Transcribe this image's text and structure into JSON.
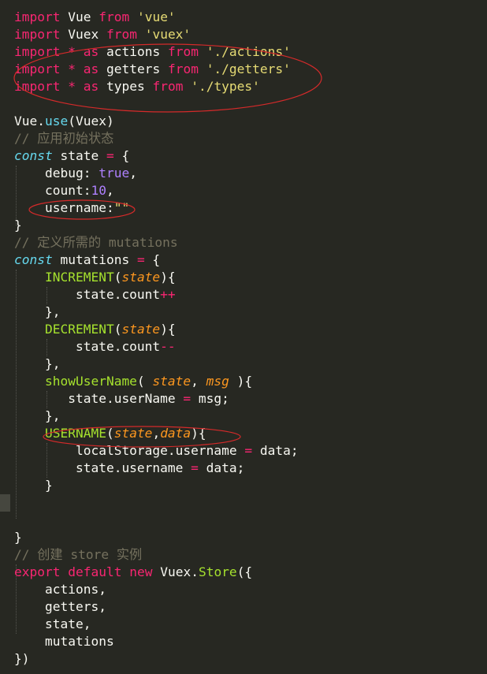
{
  "editor": {
    "annotation_color": "#D42A2A",
    "lines": [
      {
        "segments": [
          {
            "t": "import",
            "c": "kw"
          },
          {
            "t": " Vue "
          },
          {
            "t": "from",
            "c": "kw"
          },
          {
            "t": " "
          },
          {
            "t": "'vue'",
            "c": "str"
          }
        ]
      },
      {
        "segments": [
          {
            "t": "import",
            "c": "kw"
          },
          {
            "t": " Vuex "
          },
          {
            "t": "from",
            "c": "kw"
          },
          {
            "t": " "
          },
          {
            "t": "'vuex'",
            "c": "str"
          }
        ]
      },
      {
        "segments": [
          {
            "t": "import",
            "c": "kw"
          },
          {
            "t": " "
          },
          {
            "t": "*",
            "c": "kw"
          },
          {
            "t": " "
          },
          {
            "t": "as",
            "c": "kw"
          },
          {
            "t": " actions "
          },
          {
            "t": "from",
            "c": "kw"
          },
          {
            "t": " "
          },
          {
            "t": "'./actions'",
            "c": "str"
          }
        ]
      },
      {
        "segments": [
          {
            "t": "import",
            "c": "kw"
          },
          {
            "t": " "
          },
          {
            "t": "*",
            "c": "kw"
          },
          {
            "t": " "
          },
          {
            "t": "as",
            "c": "kw"
          },
          {
            "t": " getters "
          },
          {
            "t": "from",
            "c": "kw"
          },
          {
            "t": " "
          },
          {
            "t": "'./getters'",
            "c": "str"
          }
        ]
      },
      {
        "segments": [
          {
            "t": "import",
            "c": "kw"
          },
          {
            "t": " "
          },
          {
            "t": "*",
            "c": "kw"
          },
          {
            "t": " "
          },
          {
            "t": "as",
            "c": "kw"
          },
          {
            "t": " types "
          },
          {
            "t": "from",
            "c": "kw"
          },
          {
            "t": " "
          },
          {
            "t": "'./types'",
            "c": "str"
          }
        ]
      },
      {
        "segments": []
      },
      {
        "segments": [
          {
            "t": "Vue."
          },
          {
            "t": "use",
            "c": "bi"
          },
          {
            "t": "(Vuex)"
          }
        ]
      },
      {
        "segments": [
          {
            "t": "// 应用初始状态",
            "c": "cmt"
          }
        ]
      },
      {
        "segments": [
          {
            "t": "const",
            "c": "fn"
          },
          {
            "t": " state "
          },
          {
            "t": "=",
            "c": "kw"
          },
          {
            "t": " {"
          }
        ]
      },
      {
        "segments": [
          {
            "t": "    debug: "
          },
          {
            "t": "true",
            "c": "num"
          },
          {
            "t": ","
          }
        ]
      },
      {
        "segments": [
          {
            "t": "    count:"
          },
          {
            "t": "10",
            "c": "num"
          },
          {
            "t": ","
          }
        ]
      },
      {
        "segments": [
          {
            "t": "    username:"
          },
          {
            "t": "\"\"",
            "c": "str"
          }
        ]
      },
      {
        "segments": [
          {
            "t": "}"
          }
        ]
      },
      {
        "segments": [
          {
            "t": "// 定义所需的 mutations",
            "c": "cmt"
          }
        ]
      },
      {
        "segments": [
          {
            "t": "const",
            "c": "fn"
          },
          {
            "t": " mutations "
          },
          {
            "t": "=",
            "c": "kw"
          },
          {
            "t": " {"
          }
        ]
      },
      {
        "segments": [
          {
            "t": "    "
          },
          {
            "t": "INCREMENT",
            "c": "prop"
          },
          {
            "t": "("
          },
          {
            "t": "state",
            "c": "par"
          },
          {
            "t": "){"
          }
        ]
      },
      {
        "segments": [
          {
            "t": "        state.count"
          },
          {
            "t": "++",
            "c": "kw"
          }
        ]
      },
      {
        "segments": [
          {
            "t": "    },"
          }
        ]
      },
      {
        "segments": [
          {
            "t": "    "
          },
          {
            "t": "DECREMENT",
            "c": "prop"
          },
          {
            "t": "("
          },
          {
            "t": "state",
            "c": "par"
          },
          {
            "t": "){"
          }
        ]
      },
      {
        "segments": [
          {
            "t": "        state.count"
          },
          {
            "t": "--",
            "c": "kw"
          }
        ]
      },
      {
        "segments": [
          {
            "t": "    },"
          }
        ]
      },
      {
        "segments": [
          {
            "t": "    "
          },
          {
            "t": "showUserName",
            "c": "prop"
          },
          {
            "t": "( "
          },
          {
            "t": "state",
            "c": "par"
          },
          {
            "t": ", "
          },
          {
            "t": "msg",
            "c": "par"
          },
          {
            "t": " ){"
          }
        ]
      },
      {
        "segments": [
          {
            "t": "       state.userName "
          },
          {
            "t": "=",
            "c": "kw"
          },
          {
            "t": " msg;"
          }
        ]
      },
      {
        "segments": [
          {
            "t": "    },"
          }
        ]
      },
      {
        "segments": [
          {
            "t": "    "
          },
          {
            "t": "USERNAME",
            "c": "prop"
          },
          {
            "t": "("
          },
          {
            "t": "state",
            "c": "par"
          },
          {
            "t": ","
          },
          {
            "t": "data",
            "c": "par"
          },
          {
            "t": "){"
          }
        ]
      },
      {
        "segments": [
          {
            "t": "        localStorage.username "
          },
          {
            "t": "=",
            "c": "kw"
          },
          {
            "t": " data;"
          }
        ]
      },
      {
        "segments": [
          {
            "t": "        state.username "
          },
          {
            "t": "=",
            "c": "kw"
          },
          {
            "t": " data;"
          }
        ]
      },
      {
        "segments": [
          {
            "t": "    }"
          }
        ]
      },
      {
        "segments": []
      },
      {
        "segments": []
      },
      {
        "segments": [
          {
            "t": "}"
          }
        ]
      },
      {
        "segments": [
          {
            "t": "// 创建 store 实例",
            "c": "cmt"
          }
        ]
      },
      {
        "segments": [
          {
            "t": "export",
            "c": "kw"
          },
          {
            "t": " "
          },
          {
            "t": "default",
            "c": "kw"
          },
          {
            "t": " "
          },
          {
            "t": "new",
            "c": "kw"
          },
          {
            "t": " Vuex."
          },
          {
            "t": "Store",
            "c": "prop"
          },
          {
            "t": "({"
          }
        ]
      },
      {
        "segments": [
          {
            "t": "    actions,"
          }
        ]
      },
      {
        "segments": [
          {
            "t": "    getters,"
          }
        ]
      },
      {
        "segments": [
          {
            "t": "    state,"
          }
        ]
      },
      {
        "segments": [
          {
            "t": "    mutations"
          }
        ]
      },
      {
        "segments": [
          {
            "t": "})"
          }
        ]
      }
    ]
  }
}
